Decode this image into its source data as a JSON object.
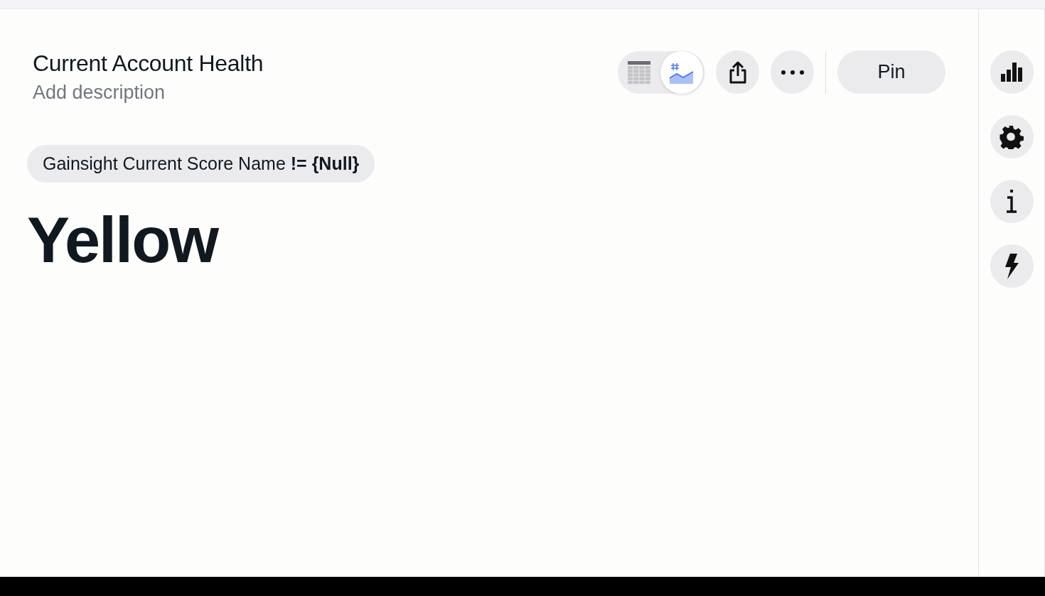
{
  "header": {
    "title": "Current Account Health",
    "description_placeholder": "Add description"
  },
  "view_toggle": [
    {
      "kind": "table",
      "selected": false
    },
    {
      "kind": "chart",
      "selected": true
    }
  ],
  "toolbar": [
    {
      "kind": "share"
    },
    {
      "kind": "more"
    }
  ],
  "pin_button": "Pin",
  "filter": "Gainsight Current Score Name **!= {Null}**",
  "value": "Yellow",
  "side_tools": [
    {
      "kind": "chart"
    },
    {
      "kind": "settings"
    },
    {
      "kind": "info"
    },
    {
      "kind": "lightning"
    }
  ]
}
